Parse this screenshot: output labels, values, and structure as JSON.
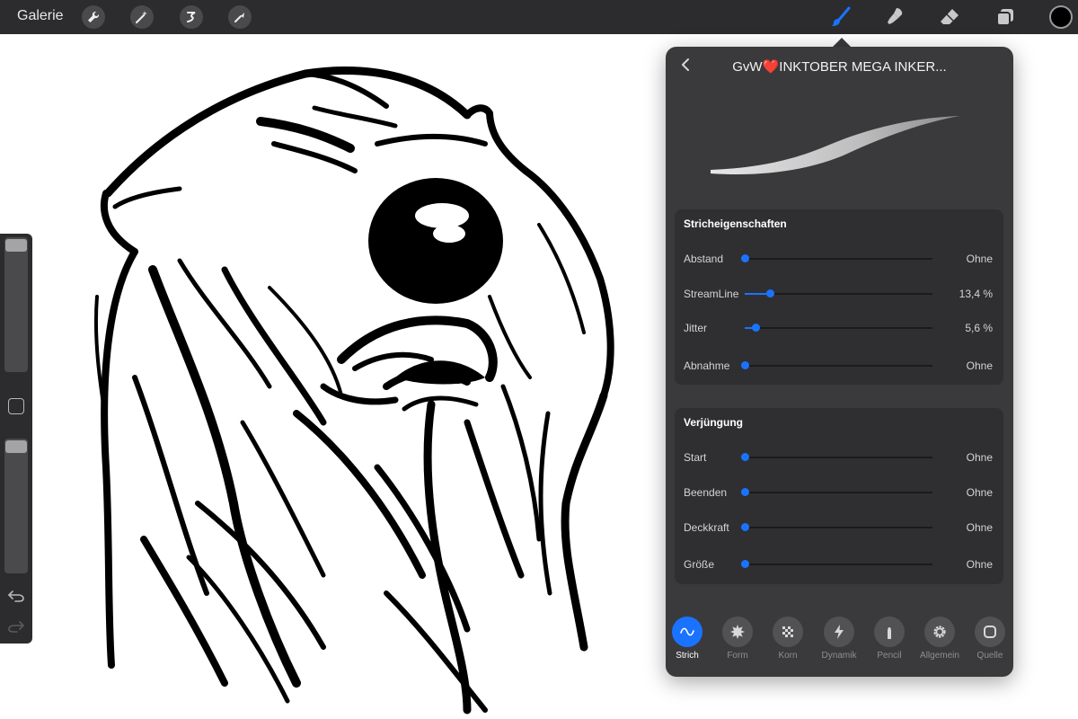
{
  "topbar": {
    "gallery_label": "Galerie",
    "tools_left": [
      {
        "icon": "wrench-icon",
        "label": "Aktionen"
      },
      {
        "icon": "magic-wand-icon",
        "label": "Anpassungen"
      },
      {
        "icon": "selection-icon",
        "label": "Auswahl"
      },
      {
        "icon": "transform-arrow-icon",
        "label": "Transformieren"
      }
    ],
    "tools_right": [
      {
        "icon": "brush-icon",
        "active": true
      },
      {
        "icon": "smudge-icon",
        "active": false
      },
      {
        "icon": "eraser-icon",
        "active": false
      },
      {
        "icon": "layers-icon",
        "active": false
      }
    ],
    "current_color": "#000000",
    "accent_color": "#1a73ff"
  },
  "sidebar": {
    "brush_size_level": 1.0,
    "opacity_level": 1.0,
    "icons": [
      "modifier-square-icon",
      "undo-icon",
      "redo-icon"
    ]
  },
  "panel": {
    "title_prefix": "GvW",
    "title_heart": "❤️",
    "title_suffix": "INKTOBER MEGA INKER...",
    "sections": [
      {
        "title": "Stricheigenschaften",
        "rows": [
          {
            "label": "Abstand",
            "value": "Ohne",
            "level": 0.0
          },
          {
            "label": "StreamLine",
            "value": "13,4 %",
            "level": 0.134
          },
          {
            "label": "Jitter",
            "value": "5,6 %",
            "level": 0.056
          },
          {
            "label": "Abnahme",
            "value": "Ohne",
            "level": 0.0
          }
        ]
      },
      {
        "title": "Verjüngung",
        "rows": [
          {
            "label": "Start",
            "value": "Ohne",
            "level": 0.0
          },
          {
            "label": "Beenden",
            "value": "Ohne",
            "level": 0.0
          },
          {
            "label": "Deckkraft",
            "value": "Ohne",
            "level": 0.0
          },
          {
            "label": "Größe",
            "value": "Ohne",
            "level": 0.0
          }
        ]
      }
    ],
    "tabs": [
      {
        "label": "Strich",
        "icon": "stroke-wave-icon",
        "active": true
      },
      {
        "label": "Form",
        "icon": "shape-burst-icon",
        "active": false
      },
      {
        "label": "Korn",
        "icon": "grain-checker-icon",
        "active": false
      },
      {
        "label": "Dynamik",
        "icon": "lightning-icon",
        "active": false
      },
      {
        "label": "Pencil",
        "icon": "pencil-tip-icon",
        "active": false
      },
      {
        "label": "Allgemein",
        "icon": "gear-icon",
        "active": false
      },
      {
        "label": "Quelle",
        "icon": "source-square-icon",
        "active": false
      }
    ]
  }
}
